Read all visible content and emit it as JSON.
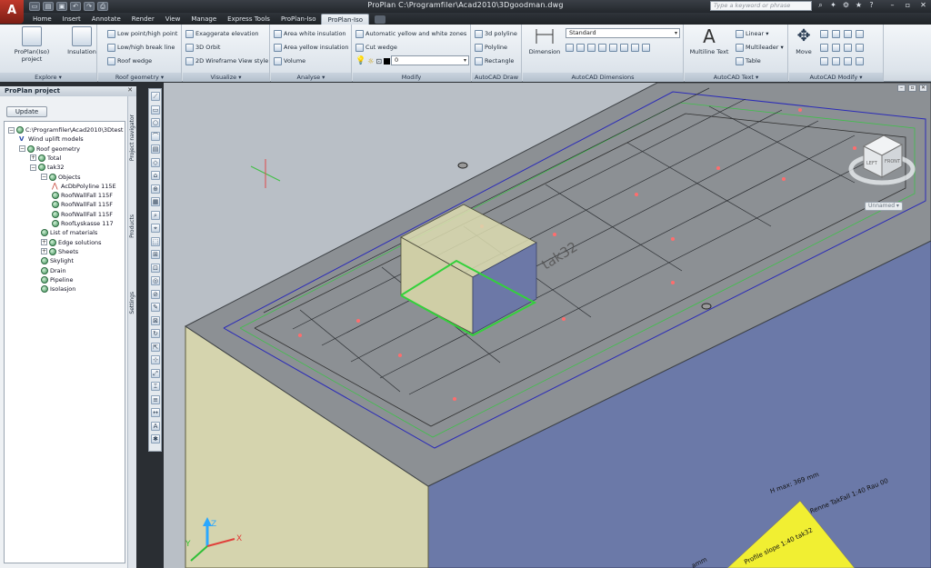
{
  "app": {
    "logo_letter": "A",
    "window_title": "ProPlan   C:\\Programfiler\\Acad2010\\3Dgoodman.dwg",
    "search_placeholder": "Type a keyword or phrase"
  },
  "tabs": [
    {
      "label": "Home"
    },
    {
      "label": "Insert"
    },
    {
      "label": "Annotate"
    },
    {
      "label": "Render"
    },
    {
      "label": "View"
    },
    {
      "label": "Manage"
    },
    {
      "label": "Express Tools"
    },
    {
      "label": "ProPlan-Iso"
    },
    {
      "label": "ProPlan-Iso",
      "active": true
    }
  ],
  "ribbon": {
    "explore": {
      "title": "Explore ▾",
      "proplan_iso_project": "ProPlan(Iso) project",
      "insulation": "Insulation"
    },
    "roof_geometry": {
      "title": "Roof geometry ▾",
      "low_high_point": "Low point/high point",
      "low_high_break_line": "Low/high break line",
      "roof_wedge": "Roof wedge"
    },
    "visualize": {
      "title": "Visualize ▾",
      "exaggerate_elevation": "Exaggerate elevation",
      "orbit_3d": "3D Orbit",
      "wireframe_2d": "2D Wireframe View style"
    },
    "analyse": {
      "title": "Analyse ▾",
      "area_white_insulation": "Area white insulation",
      "area_yellow_insulation": "Area yellow insulation",
      "volume": "Volume"
    },
    "modify": {
      "title": "Modify",
      "auto_yellow_white_zones": "Automatic yellow and white zones",
      "cut_wedge": "Cut wedge",
      "layer_value": "0"
    },
    "autocad_draw": {
      "title": "AutoCAD Draw",
      "polyline_3d": "3d polyline",
      "polyline": "Polyline",
      "rectangle": "Rectangle"
    },
    "dimensions": {
      "title": "AutoCAD Dimensions",
      "dimension": "Dimension",
      "style_value": "Standard"
    },
    "text": {
      "title": "AutoCAD Text ▾",
      "multiline_text": "Multiline Text",
      "linear": "Linear ▾",
      "multileader": "Multileader ▾",
      "table": "Table"
    },
    "autocad_modify": {
      "title": "AutoCAD Modify ▾",
      "move": "Move"
    }
  },
  "palette": {
    "title": "ProPlan project",
    "update_label": "Update",
    "side_tabs": {
      "project_navigator": "Project navigator",
      "products": "Products",
      "settings": "Settings"
    },
    "tree": [
      {
        "label": "C:\\Programfiler\\Acad2010\\3Dtest",
        "level": 0,
        "expander": "⊟",
        "icon": "green"
      },
      {
        "label": "Wind uplift models",
        "level": 1,
        "expander": "",
        "icon": "v"
      },
      {
        "label": "Roof geometry",
        "level": 1,
        "expander": "⊟",
        "icon": "green"
      },
      {
        "label": "Total",
        "level": 2,
        "expander": "⊞",
        "icon": "green"
      },
      {
        "label": "tak32",
        "level": 2,
        "expander": "⊟",
        "icon": "green"
      },
      {
        "label": "Objects",
        "level": 3,
        "expander": "⊟",
        "icon": "green"
      },
      {
        "label": "AcDbPolyline 115E",
        "level": 4,
        "expander": "",
        "icon": "red"
      },
      {
        "label": "RoofWallFall 115F",
        "level": 4,
        "expander": "",
        "icon": "green"
      },
      {
        "label": "RoofWallFall 115F",
        "level": 4,
        "expander": "",
        "icon": "green"
      },
      {
        "label": "RoofWallFall 115F",
        "level": 4,
        "expander": "",
        "icon": "green"
      },
      {
        "label": "RoofLyskasse 117",
        "level": 4,
        "expander": "",
        "icon": "green"
      },
      {
        "label": "List of materials",
        "level": 3,
        "expander": "",
        "icon": "green"
      },
      {
        "label": "Edge solutions",
        "level": 3,
        "expander": "⊞",
        "icon": "green"
      },
      {
        "label": "Sheets",
        "level": 3,
        "expander": "⊞",
        "icon": "green"
      },
      {
        "label": "Skylight",
        "level": 3,
        "expander": "",
        "icon": "green"
      },
      {
        "label": "Drain",
        "level": 3,
        "expander": "",
        "icon": "green"
      },
      {
        "label": "Pipeline",
        "level": 3,
        "expander": "",
        "icon": "green"
      },
      {
        "label": "Isolasjon",
        "level": 3,
        "expander": "",
        "icon": "green"
      }
    ]
  },
  "viewport": {
    "roof_label": "tak32",
    "dim_text": "H max: 369 mm",
    "fall_text": "Renne TakFall 1:40 Rau 00",
    "slope_text": "Profile slope 1:40 tak32",
    "partial_text": "amm",
    "viewcube_left": "LEFT",
    "viewcube_front": "FRONT",
    "unnamed_label": "Unnamed ▾",
    "ucs_x": "X",
    "ucs_y": "Y",
    "ucs_z": "Z",
    "colors": {
      "background": "#b9bfc6",
      "roof_top": "#8b8f93",
      "wall_front": "#d4d3ad",
      "wall_right": "#6a78a8",
      "green": "#33c33a",
      "marker": "#ff6a6a"
    }
  }
}
